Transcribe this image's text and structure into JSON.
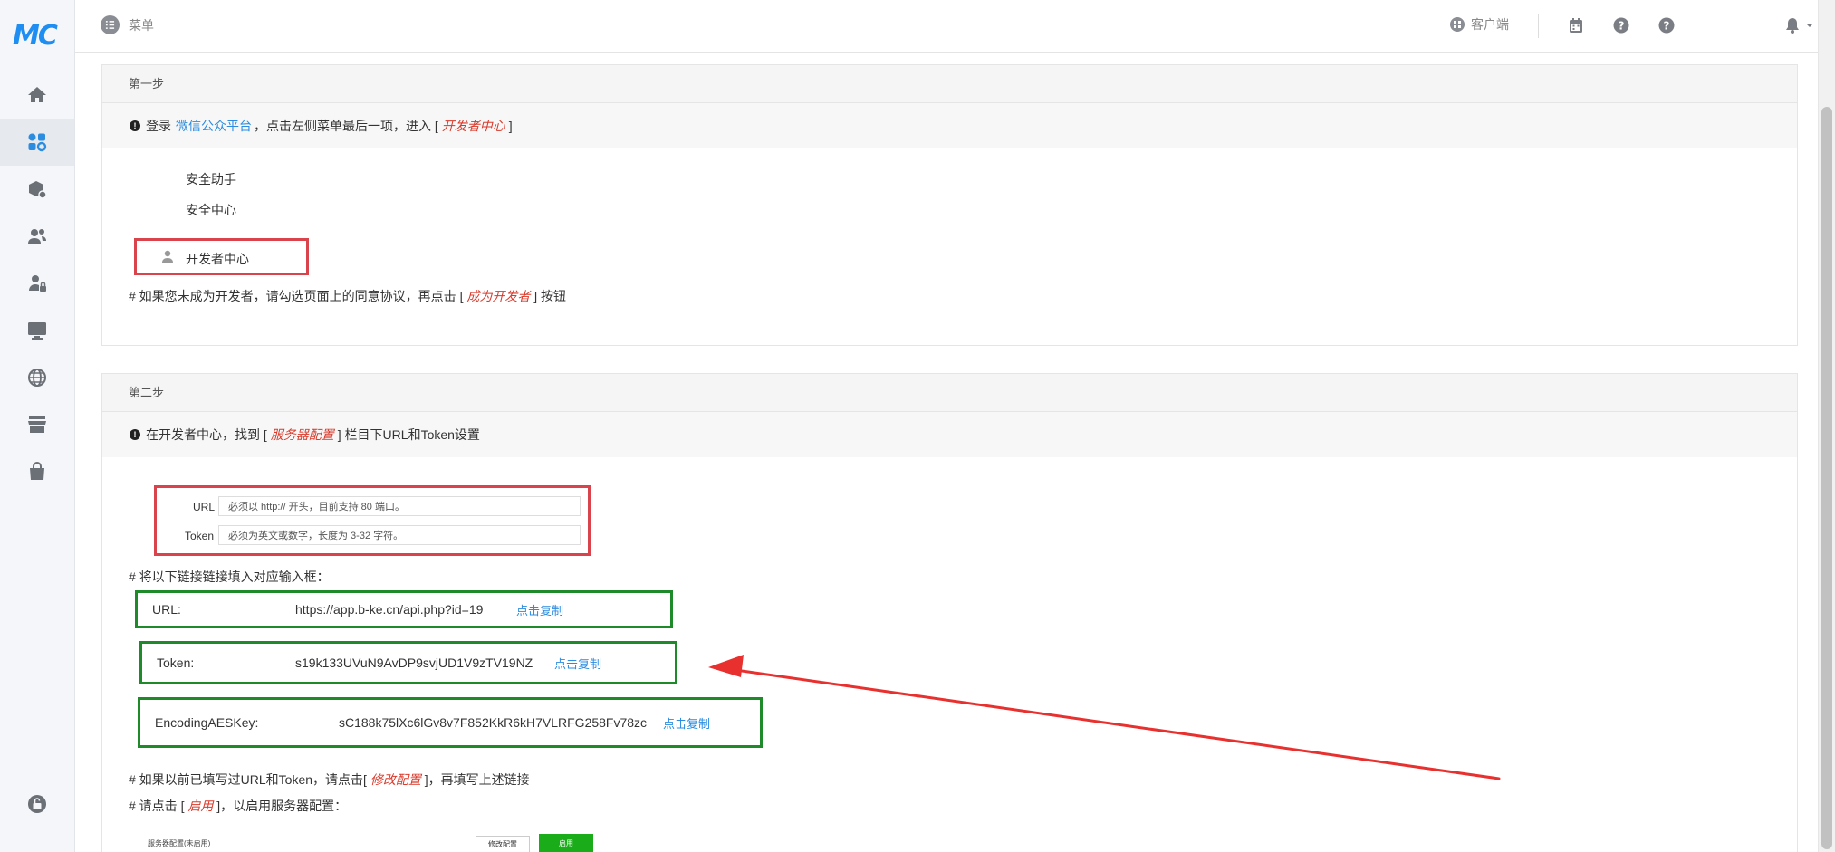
{
  "app": {
    "logo": "MC"
  },
  "sidebar": {
    "items": [
      {
        "icon": "home-icon"
      },
      {
        "icon": "apps-icon"
      },
      {
        "icon": "package-icon"
      },
      {
        "icon": "users-icon"
      },
      {
        "icon": "user-lock-icon"
      },
      {
        "icon": "monitor-icon"
      },
      {
        "icon": "globe-icon"
      },
      {
        "icon": "store-icon"
      },
      {
        "icon": "bag-icon"
      },
      {
        "icon": "unlock-icon"
      }
    ]
  },
  "header": {
    "menu_label": "菜单",
    "client_label": "客户端"
  },
  "step1": {
    "title": "第一步",
    "info_prefix": "登录",
    "info_link": "微信公众平台",
    "info_mid": "，点击左侧菜单最后一项，进入 [",
    "info_em": "开发者中心",
    "info_suffix": "]",
    "menu_items": [
      "安全助手",
      "安全中心"
    ],
    "highlight_item": "开发者中心",
    "note_prefix": "# 如果您未成为开发者，请勾选页面上的同意协议，再点击 [",
    "note_em": "成为开发者",
    "note_suffix": "] 按钮"
  },
  "step2": {
    "title": "第二步",
    "info_prefix": "在开发者中心，找到 [",
    "info_em": "服务器配置",
    "info_suffix": "] 栏目下URL和Token设置",
    "screenshot": {
      "url_label": "URL",
      "url_placeholder": "必须以 http:// 开头，目前支持 80 端口。",
      "token_label": "Token",
      "token_placeholder": "必须为英文或数字，长度为 3-32 字符。"
    },
    "fill_note": "# 将以下链接链接填入对应输入框：",
    "fields": [
      {
        "label": "URL:",
        "value": "https://app.b-ke.cn/api.php?id=19",
        "copy": "点击复制"
      },
      {
        "label": "Token:",
        "value": "s19k133UVuN9AvDP9svjUD1V9zTV19NZ",
        "copy": "点击复制"
      },
      {
        "label": "EncodingAESKey:",
        "value": "sC188k75lXc6lGv8v7F852KkR6kH7VLRFG258Fv78zc",
        "copy": "点击复制"
      }
    ],
    "modify_note_prefix": "# 如果以前已填写过URL和Token，请点击[",
    "modify_note_em": "修改配置",
    "modify_note_suffix": "]，再填写上述链接",
    "enable_note_prefix": "# 请点击 [",
    "enable_note_em": "启用",
    "enable_note_suffix": "]，以启用服务器配置：",
    "mini_screenshot": {
      "title": "服务器配置(未启用)",
      "modify_btn": "修改配置",
      "enable_btn": "启用"
    }
  },
  "colors": {
    "accent": "#1e8ef2",
    "highlight_red": "#d9434b",
    "highlight_green": "#1f8a2a",
    "arrow": "#e8312f",
    "link": "#2b8ce0"
  }
}
